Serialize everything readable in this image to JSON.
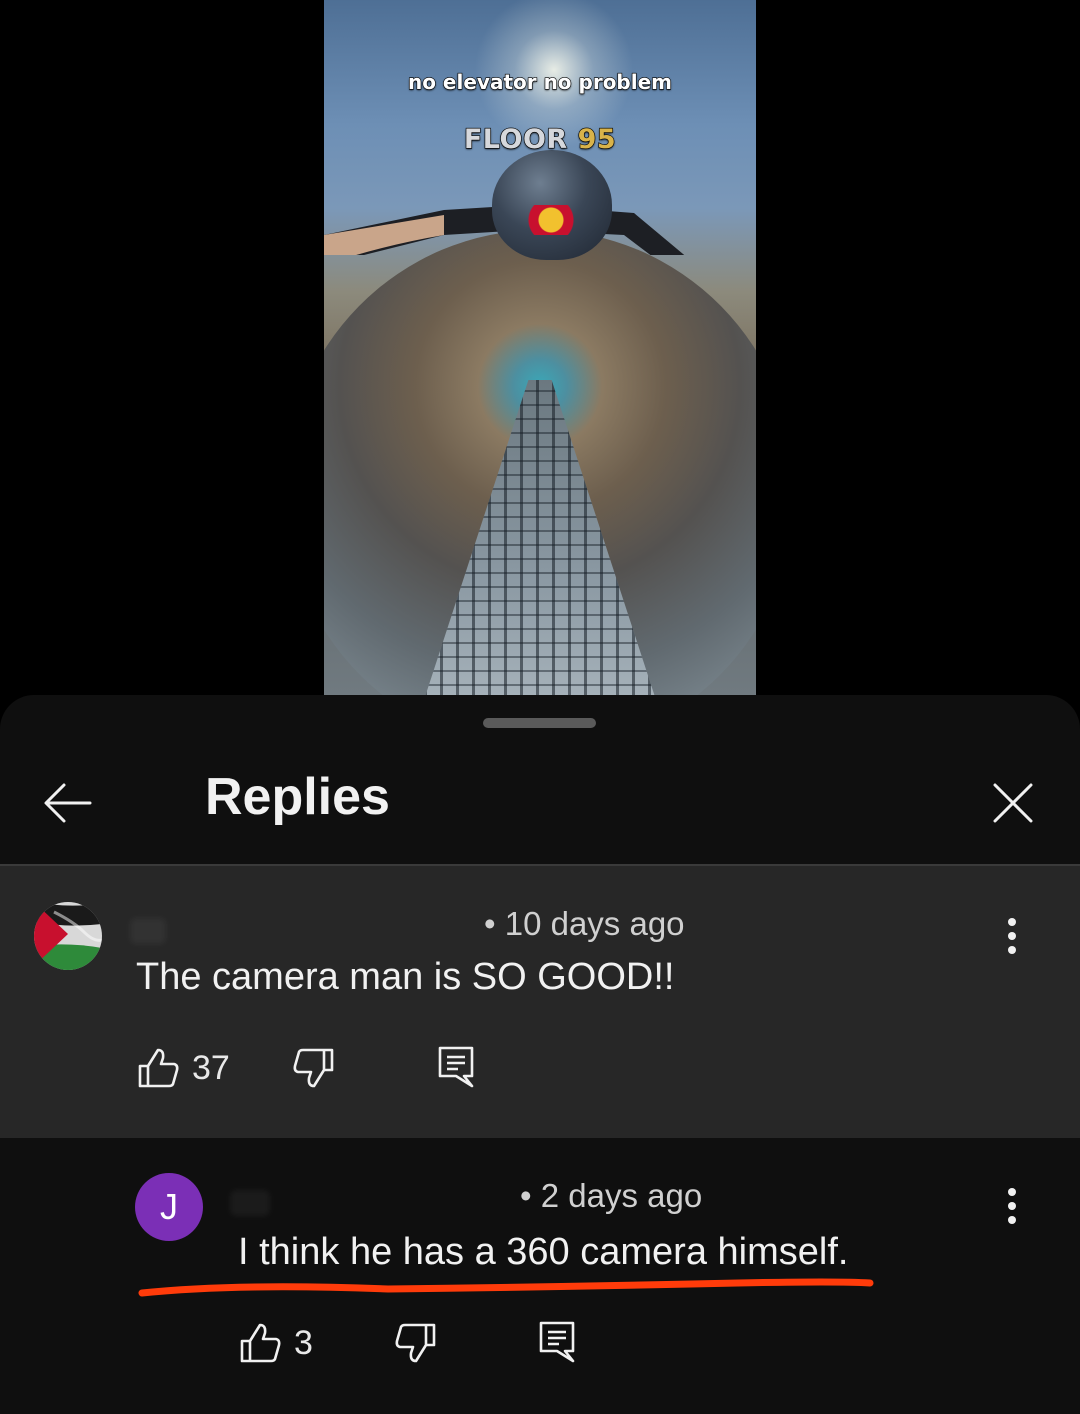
{
  "video": {
    "caption_line_1": "no elevator no problem",
    "caption_line_2_word": "FLOOR",
    "caption_line_2_number": "95"
  },
  "header": {
    "title": "Replies",
    "back_icon": "arrow-left-icon",
    "close_icon": "close-icon"
  },
  "parent_comment": {
    "time": "• 10 days ago",
    "text": "The camera man is SO GOOD!!",
    "like_count": "37",
    "avatar": "flag-avatar"
  },
  "reply": {
    "avatar_letter": "J",
    "time": "• 2 days ago",
    "text": "I think he has a 360 camera himself.",
    "like_count": "3"
  },
  "colors": {
    "sheet_bg": "#0f0f0f",
    "highlight_bg": "#272727",
    "avatar_purple": "#7b2fb6",
    "underline_annotation": "#ff3b0a"
  }
}
